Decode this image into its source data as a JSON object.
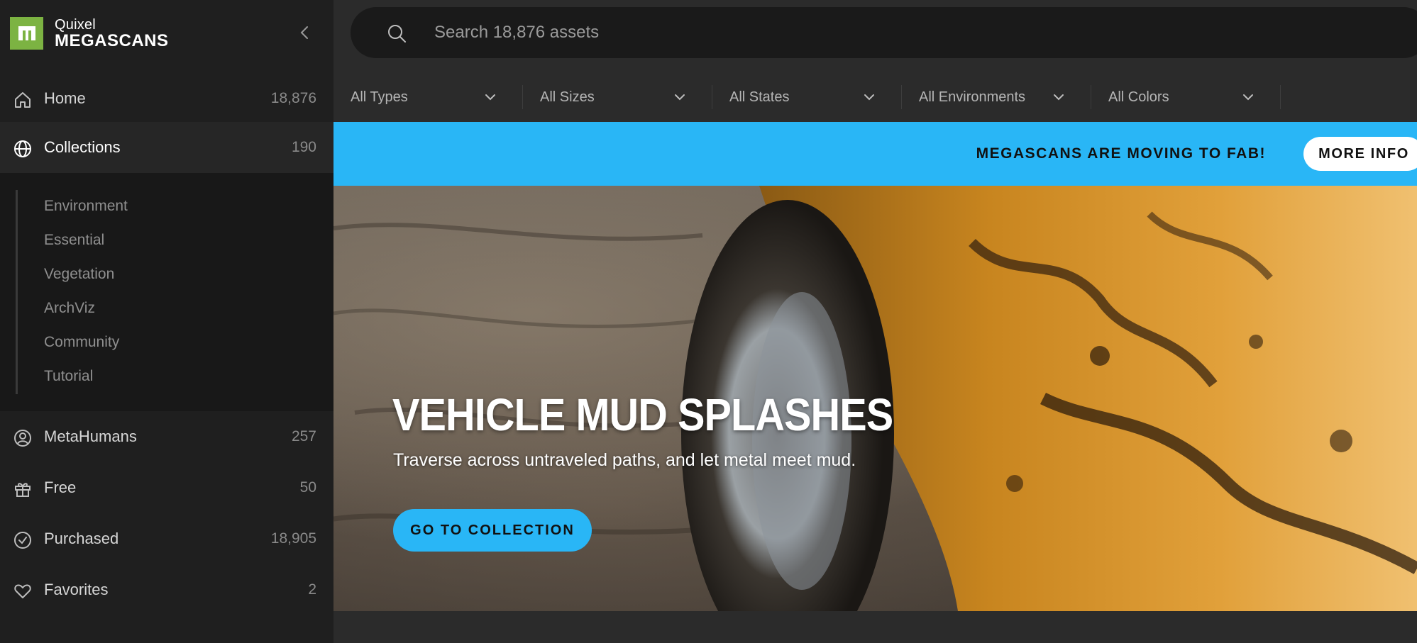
{
  "brand": {
    "top": "Quixel",
    "bottom": "MEGASCANS",
    "logo_color": "#7cb342"
  },
  "sidebar": {
    "items": [
      {
        "label": "Home",
        "count": "18,876",
        "icon": "home-icon"
      },
      {
        "label": "Collections",
        "count": "190",
        "icon": "globe-icon"
      },
      {
        "label": "MetaHumans",
        "count": "257",
        "icon": "user-circle-icon"
      },
      {
        "label": "Free",
        "count": "50",
        "icon": "gift-icon"
      },
      {
        "label": "Purchased",
        "count": "18,905",
        "icon": "check-circle-icon"
      },
      {
        "label": "Favorites",
        "count": "2",
        "icon": "heart-icon"
      }
    ],
    "collections_sub": [
      "Environment",
      "Essential",
      "Vegetation",
      "ArchViz",
      "Community",
      "Tutorial"
    ]
  },
  "search": {
    "placeholder": "Search 18,876 assets"
  },
  "filters": [
    "All Types",
    "All Sizes",
    "All States",
    "All Environments",
    "All Colors"
  ],
  "notice": {
    "text": "MEGASCANS ARE MOVING TO FAB!",
    "button": "MORE INFO",
    "color": "#29b6f6"
  },
  "hero": {
    "title": "VEHICLE MUD SPLASHES",
    "subtitle": "Traverse across untraveled paths, and let metal meet mud.",
    "cta": "GO TO COLLECTION"
  },
  "colors": {
    "sidebar_bg": "#1f1f1f",
    "main_bg": "#2b2b2b",
    "accent": "#29b6f6"
  }
}
